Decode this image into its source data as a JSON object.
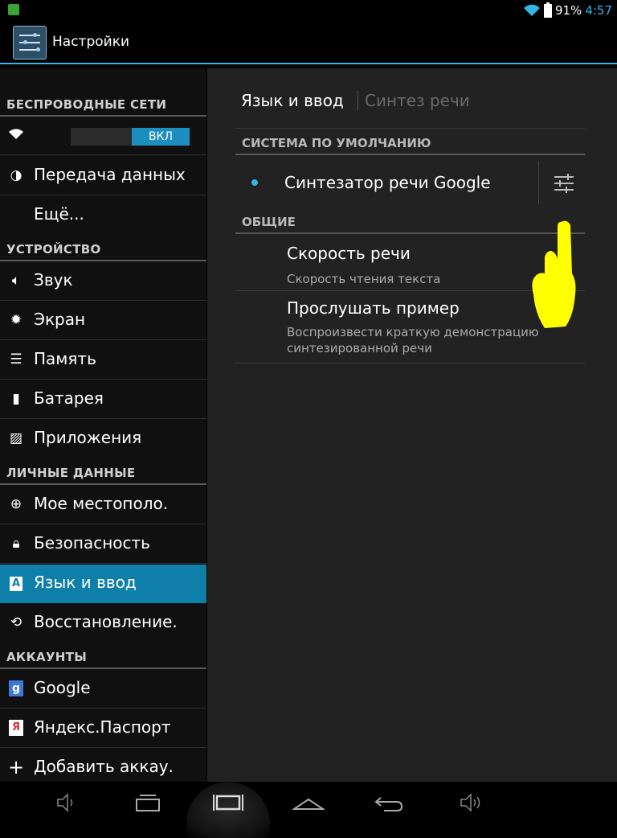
{
  "status_bar": {
    "battery_pct": "91%",
    "time": "4:57",
    "accent": "#33b5e5"
  },
  "titlebar": {
    "title": "Настройки"
  },
  "sidebar": {
    "sections": [
      {
        "label": "БЕСПРОВОДНЫЕ СЕТИ"
      },
      {
        "label": "УСТРОЙСТВО"
      },
      {
        "label": "ЛИЧНЫЕ ДАННЫЕ"
      },
      {
        "label": "АККАУНТЫ"
      }
    ],
    "wifi": {
      "icon": "wifi-icon",
      "toggle_label": "ВКЛ"
    },
    "items": [
      {
        "label": "Передача данных",
        "icon": "data-usage-icon"
      },
      {
        "label": "Ещё...",
        "icon": ""
      },
      {
        "label": "Звук",
        "icon": "sound-icon"
      },
      {
        "label": "Экран",
        "icon": "display-icon"
      },
      {
        "label": "Память",
        "icon": "storage-icon"
      },
      {
        "label": "Батарея",
        "icon": "battery-icon"
      },
      {
        "label": "Приложения",
        "icon": "apps-icon"
      },
      {
        "label": "Мое местополо.",
        "icon": "location-icon"
      },
      {
        "label": "Безопасность",
        "icon": "lock-icon"
      },
      {
        "label": "Язык и ввод",
        "icon": "language-icon",
        "active": true
      },
      {
        "label": "Восстановление.",
        "icon": "backup-icon"
      },
      {
        "label": "Google",
        "icon": "google-icon"
      },
      {
        "label": "Яндекс.Паспорт",
        "icon": "yandex-icon"
      },
      {
        "label": "Добавить аккау.",
        "icon": "add-icon"
      }
    ],
    "active_color": "#0e7fa8"
  },
  "main": {
    "breadcrumb": {
      "current": "Язык и ввод",
      "sub": "Синтез речи"
    },
    "default_section": "СИСТЕМА ПО УМОЛЧАНИЮ",
    "engine": {
      "name": "Синтезатор речи Google",
      "selected": true
    },
    "general_section": "ОБЩИЕ",
    "prefs": [
      {
        "title": "Скорость речи",
        "summary": "Скорость чтения текста"
      },
      {
        "title": "Прослушать пример",
        "summary": "Воспроизвести краткую демонстрацию синтезированной речи"
      }
    ]
  },
  "navbar": {
    "buttons": [
      "volume-down-icon",
      "back-icon",
      "recent-apps-icon",
      "home-icon",
      "return-icon",
      "volume-up-icon"
    ]
  }
}
